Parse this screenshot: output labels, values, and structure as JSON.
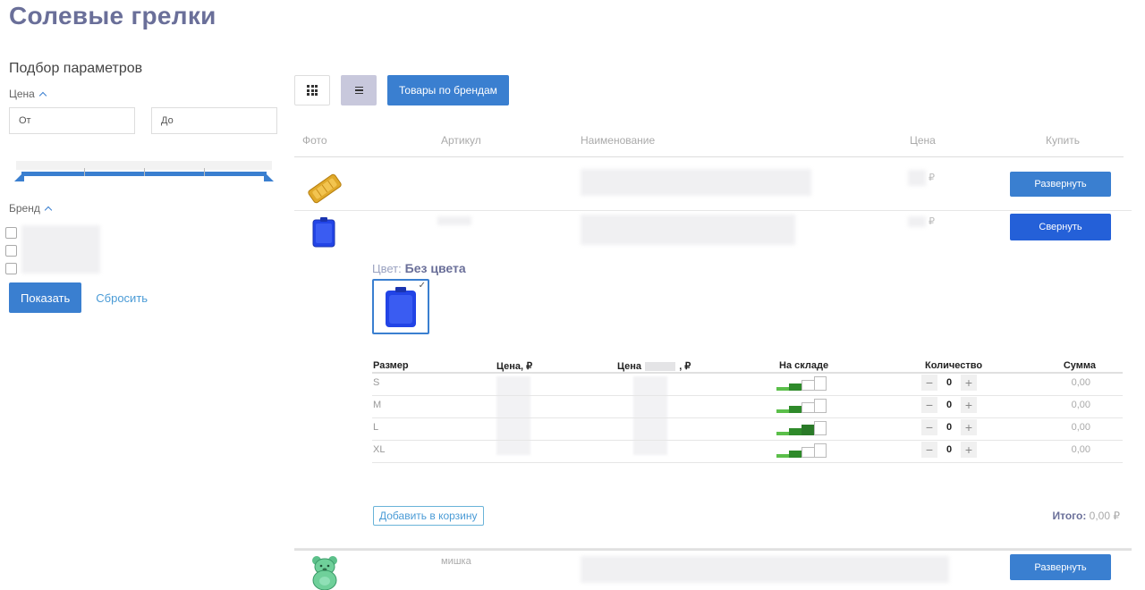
{
  "page": {
    "title": "Солевые грелки"
  },
  "sidebar": {
    "title": "Подбор параметров",
    "price_label": "Цена",
    "price_from_placeholder": "От",
    "price_to_placeholder": "До",
    "brand_label": "Бренд",
    "show_button": "Показать",
    "reset_link": "Сбросить"
  },
  "toolbar": {
    "brands_button": "Товары по брендам"
  },
  "table": {
    "headers": {
      "photo": "Фото",
      "article": "Артикул",
      "name": "Наименование",
      "price": "Цена",
      "buy": "Купить"
    }
  },
  "products": [
    {
      "price_suffix": "₽",
      "button": "Развернуть",
      "icon": "orange-heating-pad-image",
      "article": ""
    },
    {
      "price_suffix": "₽",
      "button": "Свернуть",
      "icon": "blue-heating-pad-image",
      "article": ""
    },
    {
      "price_suffix": "",
      "button": "Развернуть",
      "icon": "green-bear-heating-pad-image",
      "article": "мишка"
    }
  ],
  "expanded": {
    "color_label": "Цвет:",
    "color_value": "Без цвета",
    "size_headers": {
      "size": "Размер",
      "price": "Цена, ₽",
      "price2_prefix": "Цена",
      "price2_suffix": ", ₽",
      "stock": "На складе",
      "qty": "Количество",
      "sum": "Сумма"
    },
    "sizes": [
      {
        "size": "S",
        "qty": "0",
        "sum": "0,00",
        "stock_level": 2
      },
      {
        "size": "M",
        "qty": "0",
        "sum": "0,00",
        "stock_level": 2
      },
      {
        "size": "L",
        "qty": "0",
        "sum": "0,00",
        "stock_level": 3
      },
      {
        "size": "XL",
        "qty": "0",
        "sum": "0,00",
        "stock_level": 2
      }
    ],
    "qty_minus": "−",
    "qty_plus": "+",
    "add_to_cart": "Добавить в корзину",
    "total_label": "Итого:",
    "total_value": "0,00 ₽"
  },
  "colors": {
    "accent": "#3a7fd0",
    "accent_dark": "#2460d8",
    "title": "#6a6f99",
    "stock_green_light": "#5bbf4a",
    "stock_green_dark": "#2e8a2a"
  }
}
